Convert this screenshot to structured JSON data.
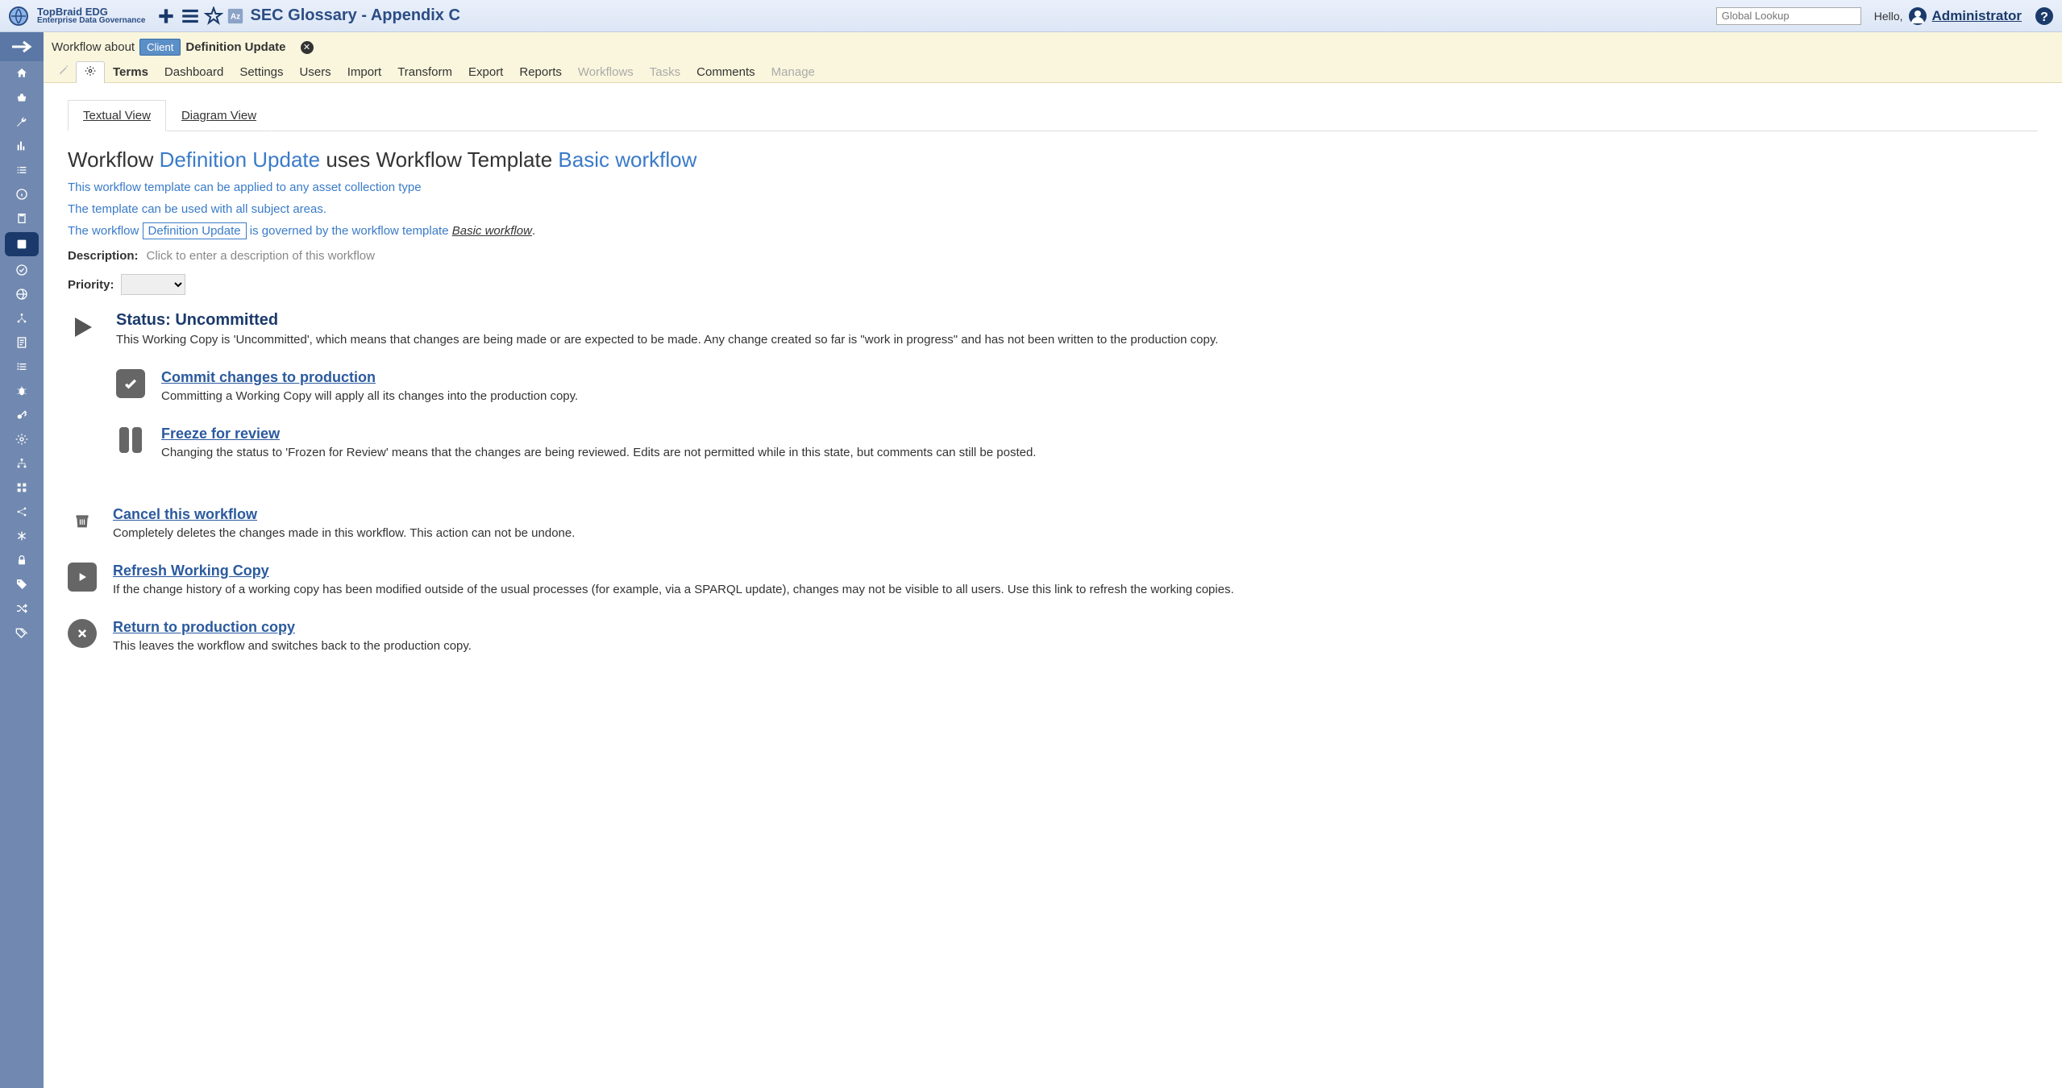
{
  "header": {
    "logo_line1": "TopBraid EDG",
    "logo_line2": "Enterprise Data Governance",
    "page_title": "SEC Glossary - Appendix C",
    "search_placeholder": "Global Lookup",
    "hello": "Hello,",
    "user": "Administrator"
  },
  "workflow_bar": {
    "prefix": "Workflow about",
    "client": "Client",
    "name": "Definition Update"
  },
  "tabs": {
    "terms": "Terms",
    "dashboard": "Dashboard",
    "settings": "Settings",
    "users": "Users",
    "import": "Import",
    "transform": "Transform",
    "export": "Export",
    "reports": "Reports",
    "workflows": "Workflows",
    "tasks": "Tasks",
    "comments": "Comments",
    "manage": "Manage"
  },
  "view_tabs": {
    "textual": "Textual View",
    "diagram": "Diagram View"
  },
  "h1": {
    "prefix": "Workflow ",
    "name": "Definition Update",
    "mid": " uses Workflow Template ",
    "template": "Basic workflow"
  },
  "info1": "This workflow template can be applied to any asset collection type",
  "info2": "The template can be used with all subject areas.",
  "info3_prefix": "The workflow ",
  "info3_chip": "Definition Update",
  "info3_mid": " is governed by the workflow template ",
  "info3_template": "Basic workflow",
  "info3_suffix": ".",
  "desc_label": "Description:",
  "desc_placeholder": "Click to enter a description of this workflow",
  "priority_label": "Priority:",
  "status": {
    "title": "Status: Uncommitted",
    "desc": "This Working Copy is 'Uncommitted', which means that changes are being made or are expected to be made. Any change created so far is \"work in progress\" and has not been written to the production copy."
  },
  "actions": {
    "commit": {
      "title": "Commit changes to production",
      "desc": "Committing a Working Copy will apply all its changes into the production copy."
    },
    "freeze": {
      "title": "Freeze for review",
      "desc": "Changing the status to 'Frozen for Review' means that the changes are being reviewed. Edits are not permitted while in this state, but comments can still be posted."
    },
    "cancel": {
      "title": "Cancel this workflow",
      "desc": "Completely deletes the changes made in this workflow. This action can not be undone."
    },
    "refresh": {
      "title": "Refresh Working Copy",
      "desc": "If the change history of a working copy has been modified outside of the usual processes (for example, via a SPARQL update), changes may not be visible to all users. Use this link to refresh the working copies."
    },
    "return": {
      "title": "Return to production copy",
      "desc": "This leaves the workflow and switches back to the production copy."
    }
  }
}
